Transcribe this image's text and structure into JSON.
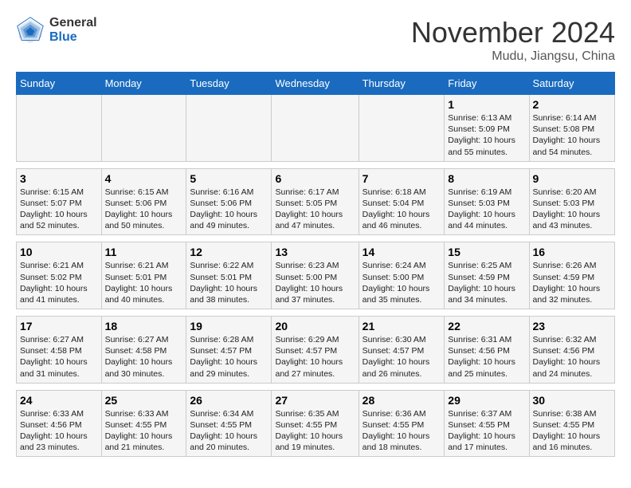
{
  "logo": {
    "general": "General",
    "blue": "Blue"
  },
  "title": "November 2024",
  "location": "Mudu, Jiangsu, China",
  "days_of_week": [
    "Sunday",
    "Monday",
    "Tuesday",
    "Wednesday",
    "Thursday",
    "Friday",
    "Saturday"
  ],
  "weeks": [
    [
      {
        "day": "",
        "info": ""
      },
      {
        "day": "",
        "info": ""
      },
      {
        "day": "",
        "info": ""
      },
      {
        "day": "",
        "info": ""
      },
      {
        "day": "",
        "info": ""
      },
      {
        "day": "1",
        "info": "Sunrise: 6:13 AM\nSunset: 5:09 PM\nDaylight: 10 hours and 55 minutes."
      },
      {
        "day": "2",
        "info": "Sunrise: 6:14 AM\nSunset: 5:08 PM\nDaylight: 10 hours and 54 minutes."
      }
    ],
    [
      {
        "day": "3",
        "info": "Sunrise: 6:15 AM\nSunset: 5:07 PM\nDaylight: 10 hours and 52 minutes."
      },
      {
        "day": "4",
        "info": "Sunrise: 6:15 AM\nSunset: 5:06 PM\nDaylight: 10 hours and 50 minutes."
      },
      {
        "day": "5",
        "info": "Sunrise: 6:16 AM\nSunset: 5:06 PM\nDaylight: 10 hours and 49 minutes."
      },
      {
        "day": "6",
        "info": "Sunrise: 6:17 AM\nSunset: 5:05 PM\nDaylight: 10 hours and 47 minutes."
      },
      {
        "day": "7",
        "info": "Sunrise: 6:18 AM\nSunset: 5:04 PM\nDaylight: 10 hours and 46 minutes."
      },
      {
        "day": "8",
        "info": "Sunrise: 6:19 AM\nSunset: 5:03 PM\nDaylight: 10 hours and 44 minutes."
      },
      {
        "day": "9",
        "info": "Sunrise: 6:20 AM\nSunset: 5:03 PM\nDaylight: 10 hours and 43 minutes."
      }
    ],
    [
      {
        "day": "10",
        "info": "Sunrise: 6:21 AM\nSunset: 5:02 PM\nDaylight: 10 hours and 41 minutes."
      },
      {
        "day": "11",
        "info": "Sunrise: 6:21 AM\nSunset: 5:01 PM\nDaylight: 10 hours and 40 minutes."
      },
      {
        "day": "12",
        "info": "Sunrise: 6:22 AM\nSunset: 5:01 PM\nDaylight: 10 hours and 38 minutes."
      },
      {
        "day": "13",
        "info": "Sunrise: 6:23 AM\nSunset: 5:00 PM\nDaylight: 10 hours and 37 minutes."
      },
      {
        "day": "14",
        "info": "Sunrise: 6:24 AM\nSunset: 5:00 PM\nDaylight: 10 hours and 35 minutes."
      },
      {
        "day": "15",
        "info": "Sunrise: 6:25 AM\nSunset: 4:59 PM\nDaylight: 10 hours and 34 minutes."
      },
      {
        "day": "16",
        "info": "Sunrise: 6:26 AM\nSunset: 4:59 PM\nDaylight: 10 hours and 32 minutes."
      }
    ],
    [
      {
        "day": "17",
        "info": "Sunrise: 6:27 AM\nSunset: 4:58 PM\nDaylight: 10 hours and 31 minutes."
      },
      {
        "day": "18",
        "info": "Sunrise: 6:27 AM\nSunset: 4:58 PM\nDaylight: 10 hours and 30 minutes."
      },
      {
        "day": "19",
        "info": "Sunrise: 6:28 AM\nSunset: 4:57 PM\nDaylight: 10 hours and 29 minutes."
      },
      {
        "day": "20",
        "info": "Sunrise: 6:29 AM\nSunset: 4:57 PM\nDaylight: 10 hours and 27 minutes."
      },
      {
        "day": "21",
        "info": "Sunrise: 6:30 AM\nSunset: 4:57 PM\nDaylight: 10 hours and 26 minutes."
      },
      {
        "day": "22",
        "info": "Sunrise: 6:31 AM\nSunset: 4:56 PM\nDaylight: 10 hours and 25 minutes."
      },
      {
        "day": "23",
        "info": "Sunrise: 6:32 AM\nSunset: 4:56 PM\nDaylight: 10 hours and 24 minutes."
      }
    ],
    [
      {
        "day": "24",
        "info": "Sunrise: 6:33 AM\nSunset: 4:56 PM\nDaylight: 10 hours and 23 minutes."
      },
      {
        "day": "25",
        "info": "Sunrise: 6:33 AM\nSunset: 4:55 PM\nDaylight: 10 hours and 21 minutes."
      },
      {
        "day": "26",
        "info": "Sunrise: 6:34 AM\nSunset: 4:55 PM\nDaylight: 10 hours and 20 minutes."
      },
      {
        "day": "27",
        "info": "Sunrise: 6:35 AM\nSunset: 4:55 PM\nDaylight: 10 hours and 19 minutes."
      },
      {
        "day": "28",
        "info": "Sunrise: 6:36 AM\nSunset: 4:55 PM\nDaylight: 10 hours and 18 minutes."
      },
      {
        "day": "29",
        "info": "Sunrise: 6:37 AM\nSunset: 4:55 PM\nDaylight: 10 hours and 17 minutes."
      },
      {
        "day": "30",
        "info": "Sunrise: 6:38 AM\nSunset: 4:55 PM\nDaylight: 10 hours and 16 minutes."
      }
    ]
  ]
}
